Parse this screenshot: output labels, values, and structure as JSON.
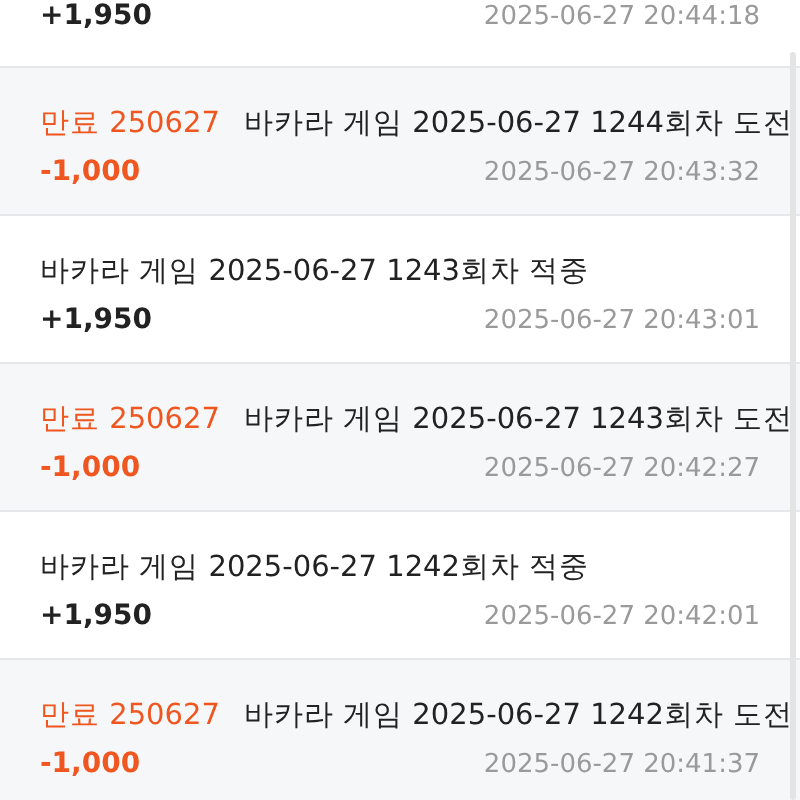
{
  "history": [
    {
      "kind": "win",
      "amount": "+1,950",
      "time": "2025-06-27 20:44:18"
    },
    {
      "kind": "expired",
      "tag": "만료 250627",
      "title": "바카라 게임 2025-06-27 1244회차 도전",
      "amount": "-1,000",
      "time": "2025-06-27 20:43:32"
    },
    {
      "kind": "win",
      "title": "바카라 게임 2025-06-27 1243회차 적중",
      "amount": "+1,950",
      "time": "2025-06-27 20:43:01"
    },
    {
      "kind": "expired",
      "tag": "만료 250627",
      "title": "바카라 게임 2025-06-27 1243회차 도전",
      "amount": "-1,000",
      "time": "2025-06-27 20:42:27"
    },
    {
      "kind": "win",
      "title": "바카라 게임 2025-06-27 1242회차 적중",
      "amount": "+1,950",
      "time": "2025-06-27 20:42:01"
    },
    {
      "kind": "expired",
      "tag": "만료 250627",
      "title": "바카라 게임 2025-06-27 1242회차 도전",
      "amount": "-1,000",
      "time": "2025-06-27 20:41:37"
    }
  ]
}
